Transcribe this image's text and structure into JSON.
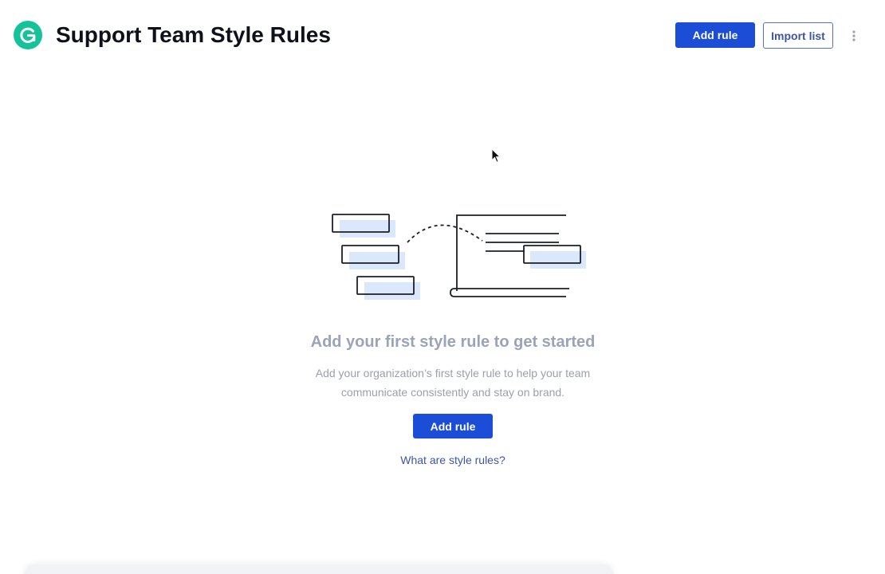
{
  "header": {
    "title": "Support Team Style Rules",
    "add_rule_label": "Add rule",
    "import_list_label": "Import list"
  },
  "empty_state": {
    "title": "Add your first style rule to get started",
    "description": "Add your organization’s first style rule to help your team communicate consistently and stay on brand.",
    "add_rule_label": "Add rule",
    "help_link_label": "What are style rules?"
  },
  "icons": {
    "logo": "grammarly-g-logo",
    "more": "vertical-ellipsis-icon",
    "cursor": "mouse-pointer-icon"
  },
  "colors": {
    "brand": "#15c39a",
    "primary_button": "#1b4dd6",
    "link": "#3d55a8",
    "highlight": "#dbe8fc"
  }
}
